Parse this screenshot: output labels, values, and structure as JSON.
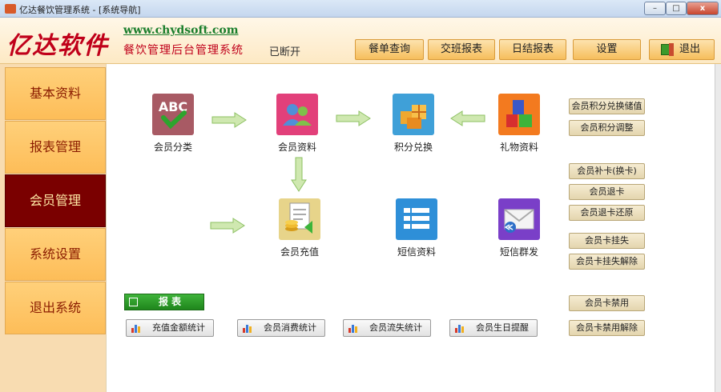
{
  "window": {
    "title": "亿达餐饮管理系统 - [系统导航]",
    "minimize": "–",
    "maximize": "□",
    "close": "x"
  },
  "header": {
    "logo_text": "亿达软件",
    "website": "www.chydsoft.com",
    "system_title": "餐饮管理后台管理系统",
    "status": "已断开",
    "buttons": {
      "order_query": "餐单查询",
      "shift_report": "交班报表",
      "daily_report": "日结报表",
      "settings": "设置",
      "exit": "退出"
    }
  },
  "sidebar": {
    "items": [
      {
        "label": "基本资料"
      },
      {
        "label": "报表管理"
      },
      {
        "label": "会员管理"
      },
      {
        "label": "系统设置"
      },
      {
        "label": "退出系统"
      }
    ]
  },
  "modules": {
    "member_category": "会员分类",
    "member_info": "会员资料",
    "points_exchange": "积分兑换",
    "gift_info": "礼物资料",
    "member_recharge": "会员充值",
    "sms_info": "短信资料",
    "sms_broadcast": "短信群发"
  },
  "side_buttons": {
    "points_to_value": "会员积分兑换储值",
    "points_adjust": "会员积分调整",
    "card_replace": "会员补卡(换卡)",
    "card_return": "会员退卡",
    "card_return_restore": "会员退卡还原",
    "card_loss": "会员卡挂失",
    "card_loss_cancel": "会员卡挂失解除",
    "card_disable": "会员卡禁用",
    "card_disable_cancel": "会员卡禁用解除"
  },
  "reports": {
    "section_label": "报表",
    "recharge_stats": "充值金额统计",
    "consume_stats": "会员消费统计",
    "churn_stats": "会员流失统计",
    "birthday_reminder": "会员生日提醒"
  },
  "colors": {
    "sidebar_active_bg": "#7a0000",
    "sidebar_item_bg": "#fdc462",
    "logo_red": "#c0001a",
    "url_green": "#1a7e2c"
  }
}
